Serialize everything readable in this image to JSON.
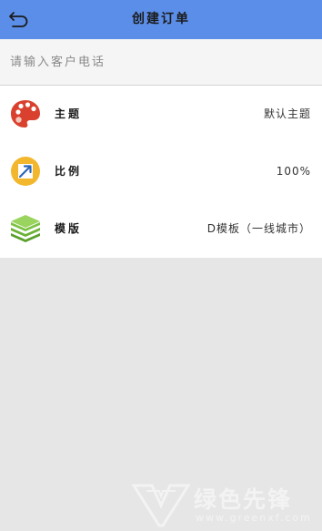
{
  "header": {
    "title": "创建订单",
    "back_icon": "back-arrow-icon"
  },
  "phone": {
    "placeholder": "请输入客户电话",
    "value": ""
  },
  "rows": [
    {
      "label": "主题",
      "value": "默认主题",
      "icon": "palette-icon",
      "icon_color": "#d9412e"
    },
    {
      "label": "比例",
      "value": "100%",
      "icon": "resize-icon",
      "icon_color": "#f2b72c"
    },
    {
      "label": "模版",
      "value": "D模板（一线城市）",
      "icon": "layers-icon",
      "icon_color": "#7cc243"
    }
  ],
  "watermark": {
    "brand": "绿色先锋",
    "url": "www.greenxf.com"
  },
  "colors": {
    "header_bg": "#5b8ee8",
    "page_bg": "#e6e6e6"
  }
}
